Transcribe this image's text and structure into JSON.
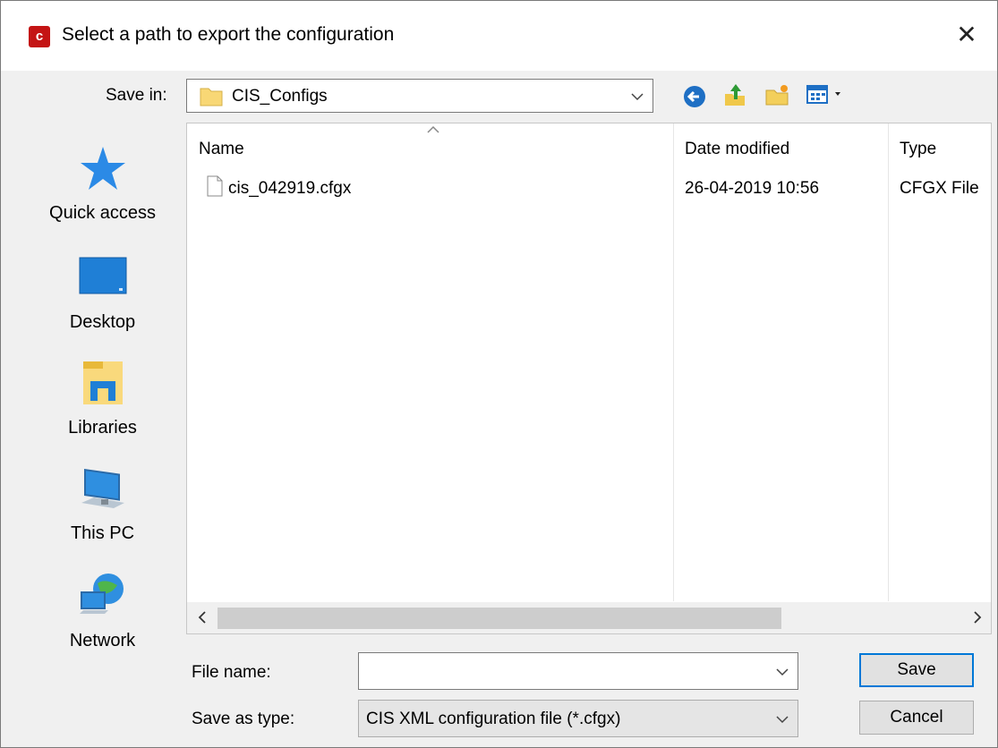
{
  "window": {
    "title": "Select a path to export the configuration",
    "close_glyph": "✕"
  },
  "toolbar": {
    "save_in_label": "Save in:",
    "location": "CIS_Configs",
    "icons": [
      "back-icon",
      "up-folder-icon",
      "new-folder-icon",
      "view-menu-icon"
    ]
  },
  "places": [
    {
      "label": "Quick access",
      "icon": "star-icon"
    },
    {
      "label": "Desktop",
      "icon": "desktop-icon"
    },
    {
      "label": "Libraries",
      "icon": "libraries-icon"
    },
    {
      "label": "This PC",
      "icon": "computer-icon"
    },
    {
      "label": "Network",
      "icon": "network-icon"
    }
  ],
  "list": {
    "columns": [
      "Name",
      "Date modified",
      "Type"
    ],
    "rows": [
      {
        "name": "cis_042919.cfgx",
        "date": "26-04-2019 10:56",
        "type": "CFGX File"
      }
    ]
  },
  "form": {
    "file_name_label": "File name:",
    "file_name_value": "",
    "save_type_label": "Save as type:",
    "save_type_value": "CIS XML configuration file (*.cfgx)"
  },
  "buttons": {
    "save": "Save",
    "cancel": "Cancel"
  },
  "colors": {
    "accent": "#0078d7",
    "app_icon": "#c41414",
    "folder": "#f8d775"
  }
}
